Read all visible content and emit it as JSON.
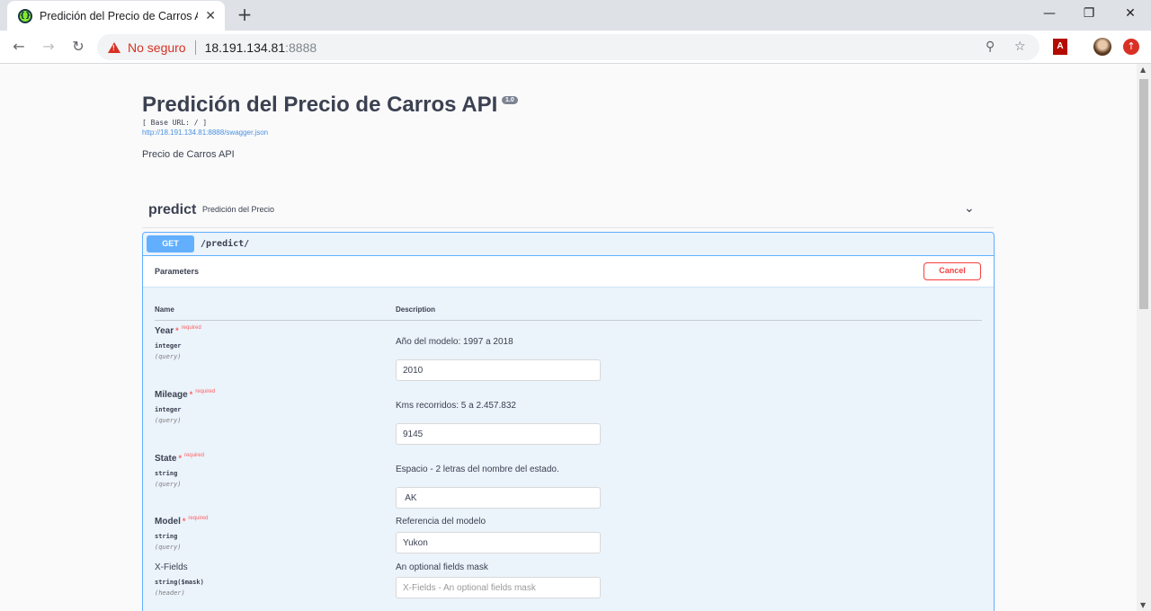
{
  "browser": {
    "tab_title": "Predición del Precio de Carros API",
    "new_tab_symbol": "+",
    "security_label": "No seguro",
    "url_host": "18.191.134.81",
    "url_port": ":8888"
  },
  "info": {
    "title": "Predición del Precio de Carros API",
    "version": "1.0",
    "base_url": "[ Base URL: / ]",
    "spec_link": "http://18.191.134.81:8888/swagger.json",
    "description": "Precio de Carros API"
  },
  "tag": {
    "name": "predict",
    "description": "Predición del Precio"
  },
  "operation": {
    "method": "GET",
    "path": "/predict/",
    "parameters_title": "Parameters",
    "cancel_label": "Cancel",
    "col_name": "Name",
    "col_description": "Description",
    "required_label": "required",
    "params": [
      {
        "name": "Year",
        "type": "integer",
        "in": "(query)",
        "description": "Año del modelo: 1997 a 2018",
        "value": "2010",
        "placeholder": ""
      },
      {
        "name": "Mileage",
        "type": "integer",
        "in": "(query)",
        "description": "Kms recorridos: 5 a 2.457.832",
        "value": "9145",
        "placeholder": ""
      },
      {
        "name": "State",
        "type": "string",
        "in": "(query)",
        "description": "Espacio - 2 letras del nombre del estado.",
        "value": " AK",
        "placeholder": ""
      },
      {
        "name": "Model",
        "type": "string",
        "in": "(query)",
        "description": "Referencia del modelo",
        "value": "Yukon",
        "placeholder": ""
      },
      {
        "name": "X-Fields",
        "type": "string($mask)",
        "in": "(header)",
        "description": "An optional fields mask",
        "value": "",
        "placeholder": "X-Fields - An optional fields mask"
      }
    ]
  }
}
